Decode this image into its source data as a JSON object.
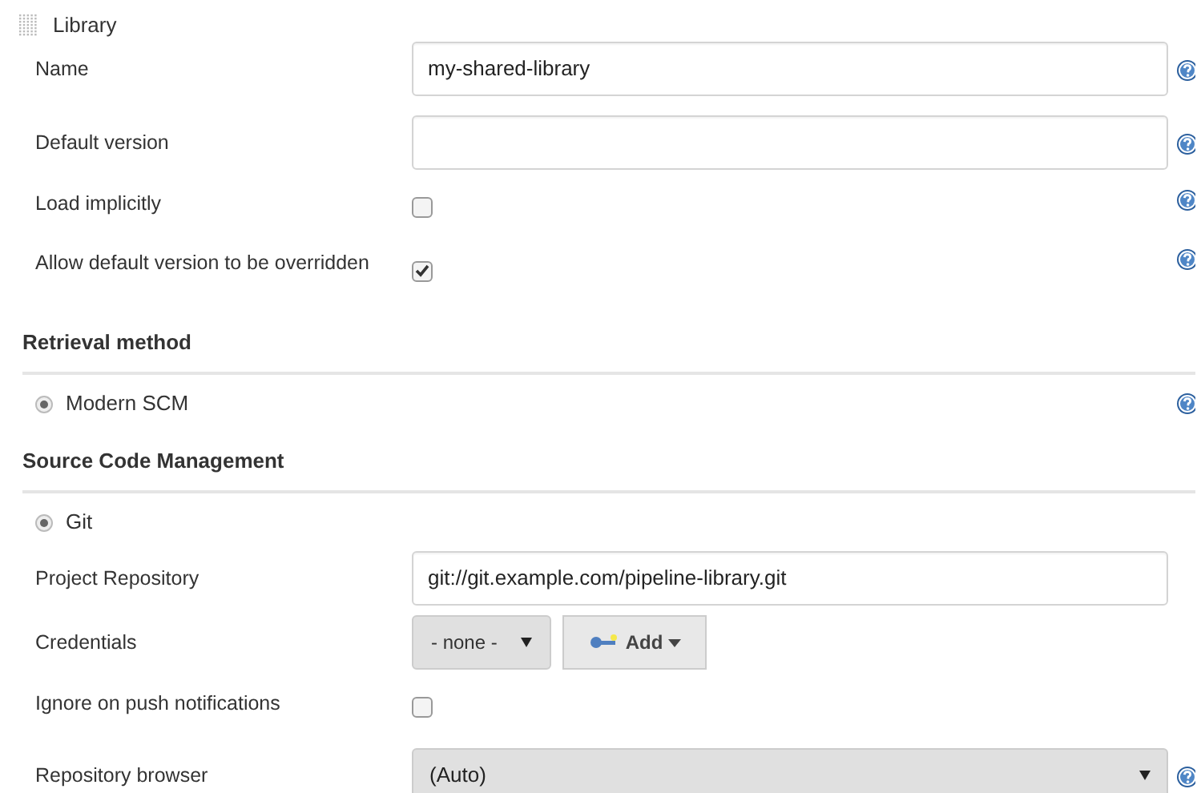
{
  "section": {
    "title": "Library"
  },
  "fields": [
    {
      "kind": "text",
      "label": "Name",
      "value": "my-shared-library",
      "help": true
    },
    {
      "kind": "text",
      "label": "Default version",
      "help": true
    },
    {
      "kind": "checkbox",
      "label": "Load implicitly",
      "checked": false,
      "help": true
    },
    {
      "kind": "checkbox",
      "label": "Allow default version to be overridden",
      "checked": true,
      "help": true
    }
  ],
  "retrieval": {
    "title": "Retrieval method",
    "options": [
      {
        "label": "Modern SCM",
        "selected": true,
        "help": true
      }
    ]
  },
  "scm": {
    "title": "Source Code Management",
    "options": [
      {
        "label": "Git",
        "selected": true,
        "help": false
      }
    ],
    "fields": [
      {
        "kind": "text",
        "label": "Project Repository",
        "value": "git://git.example.com/pipeline-library.git",
        "help": false
      },
      {
        "kind": "credentials",
        "label": "Credentials",
        "select": "- none -",
        "button": "Add",
        "help": false
      },
      {
        "kind": "checkbox",
        "label": "Ignore on push notifications",
        "checked": false,
        "help": false
      },
      {
        "kind": "select",
        "label": "Repository browser",
        "value": "(Auto)",
        "help": true
      }
    ]
  }
}
